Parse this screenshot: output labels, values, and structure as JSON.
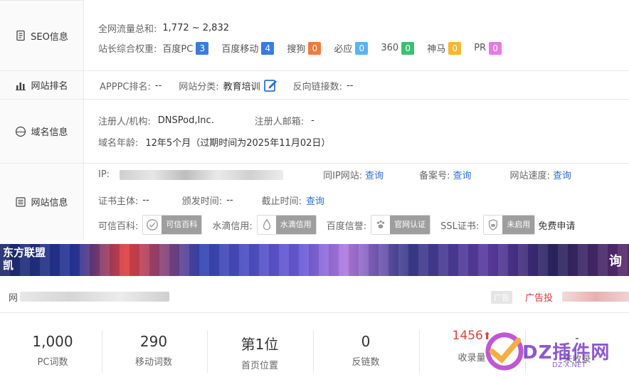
{
  "seo": {
    "label": "SEO信息",
    "total_label": "全网流量总和:",
    "total_value": "1,772 ~ 2,832",
    "weight_label": "站长综合权重:",
    "weights": [
      {
        "name": "百度PC",
        "value": "3",
        "color": "#3b7be0"
      },
      {
        "name": "百度移动",
        "value": "4",
        "color": "#3b7be0"
      },
      {
        "name": "搜狗",
        "value": "0",
        "color": "#f07b3f"
      },
      {
        "name": "必应",
        "value": "0",
        "color": "#5bb3f0"
      },
      {
        "name": "360",
        "value": "0",
        "color": "#3cc06e"
      },
      {
        "name": "神马",
        "value": "0",
        "color": "#f5b830"
      },
      {
        "name": "PR",
        "value": "0",
        "color": "#e77be6"
      }
    ]
  },
  "rank": {
    "label": "网站排名",
    "apppc_label": "APPPC排名:",
    "apppc_value": "--",
    "category_label": "网站分类:",
    "category_value": "教育培训",
    "backlinks_label": "反向链接数:",
    "backlinks_value": "--"
  },
  "domain": {
    "label": "域名信息",
    "registrant_label": "注册人/机构:",
    "registrant_value": "DNSPod,Inc.",
    "email_label": "注册人邮箱:",
    "email_value": "-",
    "age_label": "域名年龄:",
    "age_value": "12年5个月（过期时间为2025年11月02日）"
  },
  "site": {
    "label": "网站信息",
    "ip_label": "IP:",
    "same_ip_label": "同IP网站:",
    "same_ip_link": "查询",
    "icp_label": "备案号:",
    "icp_link": "查询",
    "speed_label": "网站速度:",
    "speed_link": "查询",
    "cert_subject_label": "证书主体:",
    "cert_subject_value": "--",
    "issue_label": "颁发时间:",
    "issue_value": "--",
    "expire_label": "截止时间:",
    "expire_link": "查询",
    "kexin_label": "可信百科:",
    "kexin_badge": "可信百科",
    "shuidi_label": "水滴信用:",
    "shuidi_badge": "水滴信用",
    "baidu_label": "百度信誉:",
    "baidu_badge": "官网认证",
    "ssl_label": "SSL证书:",
    "ssl_badge": "未启用",
    "ssl_apply": "免费申请"
  },
  "ad": {
    "banner_left_line1": "东方联盟",
    "banner_left_line2": "凯",
    "banner_right": "询",
    "row_left": "网",
    "ad_tag": "广告",
    "ad_link": "广告投"
  },
  "stats": [
    {
      "value": "1,000",
      "label": "PC词数"
    },
    {
      "value": "290",
      "label": "移动词数"
    },
    {
      "value": "第1位",
      "label": "首页位置"
    },
    {
      "value": "0",
      "label": "反链数"
    },
    {
      "value": "1456",
      "label": "收录量",
      "arrow": "⬆"
    },
    {
      "value": "-",
      "label": "未收录"
    }
  ],
  "watermark": {
    "brand": "DZ插件网",
    "url": "DZ-X.NET"
  }
}
